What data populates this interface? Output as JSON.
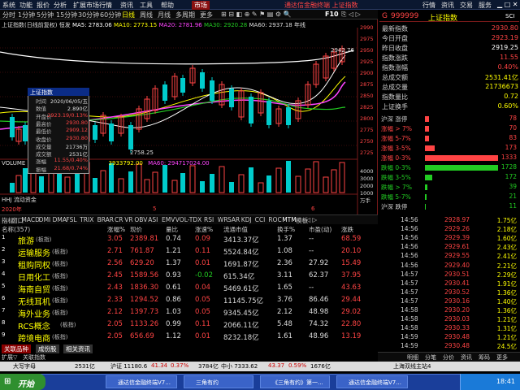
{
  "menubar": {
    "items": [
      "系统",
      "功能",
      "报价",
      "分析",
      "扩展市场行情",
      "资讯",
      "工具",
      "帮助"
    ],
    "market_tab": "市场",
    "window_title": "通达信金融终端 上证指数",
    "right_items": [
      "行情",
      "资讯",
      "交易",
      "服务"
    ]
  },
  "periods": [
    "分时",
    "1分钟",
    "5分钟",
    "15分钟",
    "30分钟",
    "60分钟",
    "日线",
    "周线",
    "月线",
    "多周期",
    "更多"
  ],
  "chart": {
    "header_prefix": "上证指数(日线前复权)",
    "ma_label": "恒发 ",
    "ma5_label": "MA5: 2783.06",
    "ma10_label": "MA10: 2773.15",
    "ma20_label": "MA20: 2781.96",
    "ma30_label": "MA30: 2920.28",
    "ma60_label": "MA60: 2937.18",
    "annual_label": "年线",
    "price_axis": [
      "2990",
      "2975",
      "2950",
      "2925",
      "2900",
      "2875",
      "2850",
      "2825",
      "2800",
      "2775",
      "2750",
      "2725"
    ],
    "high_label": "2942.76",
    "low_label": "2758.25",
    "volume_header": "VOLUME",
    "volume_value": "3933792.00",
    "volume_ma": "MA60: 294717024.00",
    "vol_axis": [
      "4000",
      "3000",
      "2000",
      "1000"
    ],
    "vol_unit": "万手",
    "hhj_label": "HHJ 流动资金",
    "year_label": "2020年",
    "month_labels": [
      "5",
      "6"
    ],
    "right_nav": "日线"
  },
  "popup": {
    "title": "上证指数",
    "labels": [
      "时间",
      "数值",
      "开盘价",
      "最高价",
      "最低价",
      "收盘价",
      "成交量",
      "成交额",
      "涨幅",
      "振幅"
    ],
    "values": [
      "2020/06/05/五",
      "2.890亿",
      "2923.19/0.13%",
      "2930.80",
      "2909.12",
      "2930.80",
      "21736万",
      "2531亿",
      "11.55/0.40%",
      "21.68/0.74%"
    ],
    "value_colors": [
      "#ddd",
      "#ddd",
      "#ff4444",
      "#ff4444",
      "#ff4444",
      "#ff4444",
      "#ddd",
      "#ddd",
      "#ff4444",
      "#ff4444"
    ]
  },
  "quote": {
    "code": "999999",
    "name": "上证指数",
    "badge": "SCI",
    "stats": [
      {
        "label": "最新指数",
        "value": "2930.80",
        "color": "#ff4444"
      },
      {
        "label": "今日开盘",
        "value": "2923.19",
        "color": "#ff4444"
      },
      {
        "label": "昨日收盘",
        "value": "2919.25",
        "color": "#ffffff"
      },
      {
        "label": "指数涨跌",
        "value": "11.55",
        "color": "#ff4444"
      },
      {
        "label": "指数涨幅",
        "value": "0.40%",
        "color": "#ff4444"
      },
      {
        "label": "总成交额",
        "value": "2531.41亿",
        "color": "#ffff00"
      },
      {
        "label": "总成交量",
        "value": "21736673",
        "color": "#ffff00"
      },
      {
        "label": "指数量比",
        "value": "0.72",
        "color": "#ffff00"
      },
      {
        "label": "上证换手",
        "value": "0.60%",
        "color": "#ffff00"
      }
    ],
    "dist": [
      {
        "label": "沪深 涨停",
        "value": "78",
        "color": "#ff4444",
        "frac": 0.06
      },
      {
        "label": "涨幅 > 7%",
        "value": "70",
        "color": "#ff4444",
        "frac": 0.05
      },
      {
        "label": "涨幅 5-7%",
        "value": "83",
        "color": "#ff4444",
        "frac": 0.06
      },
      {
        "label": "涨幅 3-5%",
        "value": "173",
        "color": "#ff4444",
        "frac": 0.13
      },
      {
        "label": "涨幅 0-3%",
        "value": "1333",
        "color": "#ff4444",
        "frac": 1.0
      },
      {
        "label": "跌幅 0-3%",
        "value": "1728",
        "color": "#22cc22",
        "frac": 1.0
      },
      {
        "label": "跌幅 3-5%",
        "value": "172",
        "color": "#22cc22",
        "frac": 0.1
      },
      {
        "label": "跌幅 > 7%",
        "value": "39",
        "color": "#22cc22",
        "frac": 0.03
      },
      {
        "label": "跌幅 5-7%",
        "value": "21",
        "color": "#22cc22",
        "frac": 0.02
      },
      {
        "label": "沪深 跌停",
        "value": "11",
        "color": "#22cc22",
        "frac": 0.01
      }
    ]
  },
  "ticks": [
    {
      "time": "14:56",
      "price": "2928.97",
      "vol": "1.75亿"
    },
    {
      "time": "14:56",
      "price": "2929.26",
      "vol": "2.18亿"
    },
    {
      "time": "14:56",
      "price": "2929.39",
      "vol": "1.60亿"
    },
    {
      "time": "14:56",
      "price": "2929.61",
      "vol": "2.43亿"
    },
    {
      "time": "14:56",
      "price": "2929.55",
      "vol": "2.41亿"
    },
    {
      "time": "14:56",
      "price": "2929.40",
      "vol": "2.21亿"
    },
    {
      "time": "14:57",
      "price": "2930.51",
      "vol": "2.29亿"
    },
    {
      "time": "14:57",
      "price": "2930.41",
      "vol": "1.91亿"
    },
    {
      "time": "14:57",
      "price": "2930.52",
      "vol": "1.36亿"
    },
    {
      "time": "14:57",
      "price": "2930.16",
      "vol": "1.40亿"
    },
    {
      "time": "14:58",
      "price": "2930.20",
      "vol": "1.36亿"
    },
    {
      "time": "14:58",
      "price": "2930.03",
      "vol": "1.21亿"
    },
    {
      "time": "14:58",
      "price": "2930.33",
      "vol": "1.31亿"
    },
    {
      "time": "14:59",
      "price": "2930.48",
      "vol": "1.21亿"
    },
    {
      "time": "14:59",
      "price": "2930.48",
      "vol": "24.5亿"
    }
  ],
  "tick_tabs": [
    "明细",
    "分笔",
    "分价",
    "资讯",
    "筹码",
    "更多"
  ],
  "indicator_tabs": [
    "指标",
    "窗口",
    "MACD",
    "DMI",
    "DMA",
    "FSL",
    "TRIX",
    "BRAR",
    "CR",
    "VR",
    "OBV",
    "ASI",
    "EMV",
    "VOL-TDX",
    "RSI",
    "WR",
    "SAR",
    "KDJ",
    "CCI",
    "ROC",
    "MTM",
    "模板",
    "◁ ▷"
  ],
  "table": {
    "headers": [
      "名称(357)",
      "涨幅%",
      "现价",
      "量比",
      "涨速%",
      "流通市值",
      "换手%",
      "市盈(动)",
      "涨跌"
    ],
    "rows": [
      [
        "旅游",
        "(板指)",
        "3.05",
        "2389.81",
        "0.74",
        "0.09",
        "3413.37亿",
        "1.37",
        "--",
        "68.59"
      ],
      [
        "运输服务",
        "(板指)",
        "2.71",
        "761.87",
        "1.21",
        "0.11",
        "5524.84亿",
        "1.08",
        "--",
        "20.10"
      ],
      [
        "租购同权",
        "(板指)",
        "2.56",
        "629.20",
        "1.37",
        "0.01",
        "1691.87亿",
        "2.36",
        "27.92",
        "15.49"
      ],
      [
        "日用化工",
        "(板指)",
        "2.45",
        "1589.56",
        "0.93",
        "-0.02",
        "615.34亿",
        "3.11",
        "62.37",
        "37.95"
      ],
      [
        "海南自贸",
        "(板指)",
        "2.43",
        "1836.30",
        "0.61",
        "0.04",
        "5469.61亿",
        "1.65",
        "--",
        "43.63"
      ],
      [
        "无线耳机",
        "(板指)",
        "2.33",
        "1294.52",
        "0.86",
        "0.05",
        "11145.75亿",
        "3.76",
        "86.46",
        "29.44"
      ],
      [
        "海外业务",
        "(板指)",
        "2.12",
        "1397.73",
        "1.03",
        "0.05",
        "9345.45亿",
        "2.12",
        "48.98",
        "29.02"
      ],
      [
        "RCS概念",
        "(板指)",
        "2.05",
        "1133.26",
        "0.99",
        "0.11",
        "2066.11亿",
        "5.48",
        "74.32",
        "22.80"
      ],
      [
        "跨境电商",
        "(板指)",
        "2.05",
        "656.69",
        "1.12",
        "0.01",
        "8232.18亿",
        "1.61",
        "48.96",
        "13.19"
      ]
    ]
  },
  "bottom_tabs": [
    "关联品种",
    "成份股",
    "相关资讯"
  ],
  "bottom_row": [
    "扩展▽",
    "关联指数"
  ],
  "status": {
    "items": [
      "大写字母",
      "2531亿",
      "沪证 11180.6",
      "41.34",
      "0.37%",
      "3784亿",
      "中小 7333.62",
      "43.37",
      "0.59%",
      "1676亿",
      "上海双线主站4"
    ]
  },
  "taskbar": {
    "start": "开始",
    "tasks": [
      "通达信金融终端V7...",
      "三角有约",
      "《三角有约》第一...",
      "通达信金融终端V7..."
    ],
    "clock": "18:41"
  }
}
